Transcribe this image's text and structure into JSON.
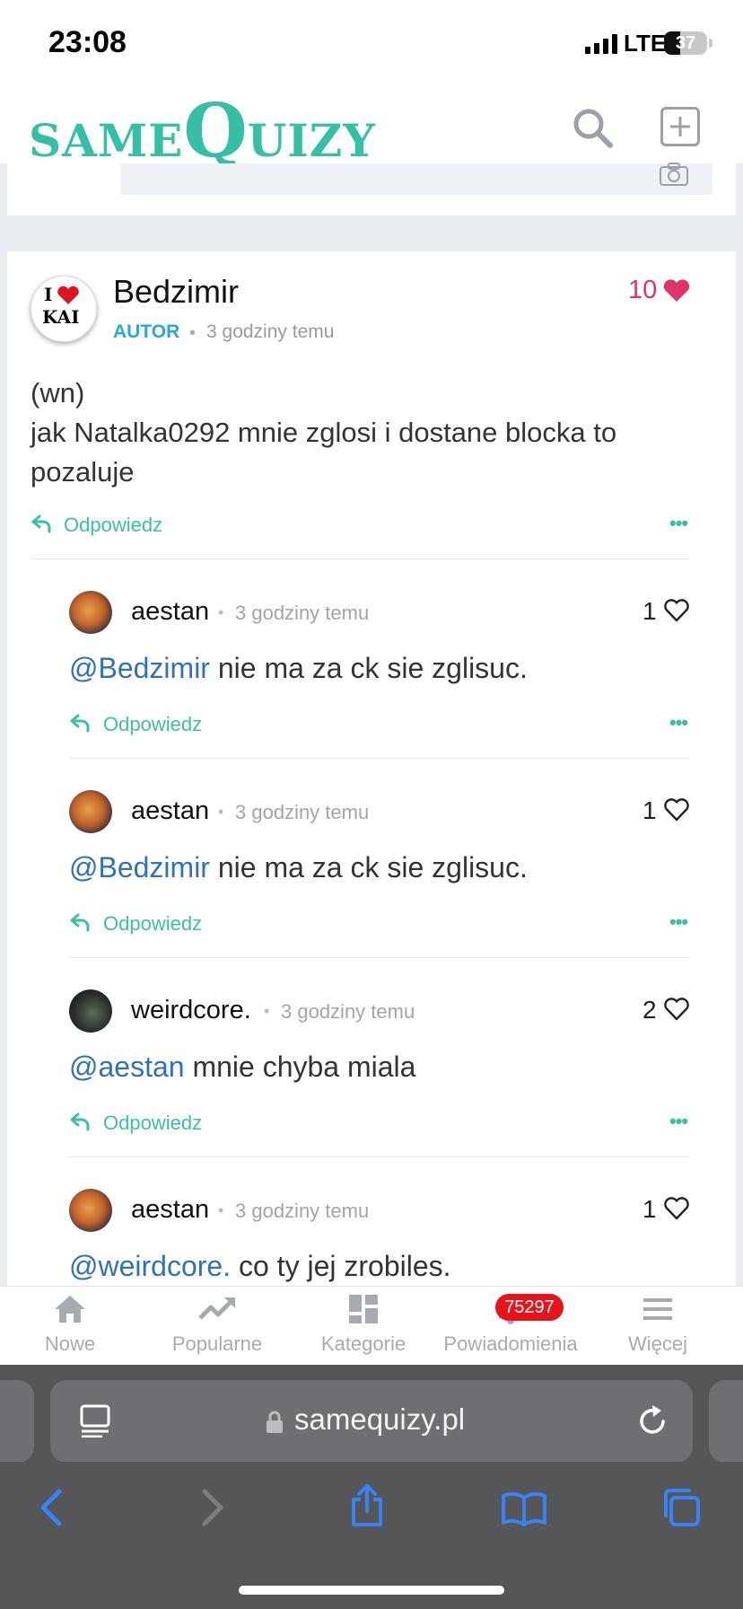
{
  "status_bar": {
    "time": "23:08",
    "network": "LTE",
    "battery": "37",
    "battery_level": 0.37
  },
  "header": {
    "logo_small": "SAME",
    "logo_big": "Q",
    "logo_rest": "UIZY"
  },
  "main_comment": {
    "author": "Bedzimir",
    "avatar_line1": "I",
    "avatar_line2": "KAI",
    "role": "AUTOR",
    "time": "3 godziny temu",
    "likes": "10",
    "text_line1": "(wn)",
    "text_line2": "jak Natalka0292 mnie zglosi i dostane blocka to pozaluje",
    "reply_label": "Odpowiedz",
    "more_label": "•••"
  },
  "replies": [
    {
      "author": "aestan",
      "time": "3 godziny temu",
      "likes": "1",
      "mention": "@Bedzimir",
      "text": " nie ma za ck sie zglisuc.",
      "reply_label": "Odpowiedz",
      "more_label": "•••"
    },
    {
      "author": "aestan",
      "time": "3 godziny temu",
      "likes": "1",
      "mention": "@Bedzimir",
      "text": " nie ma za ck sie zglisuc.",
      "reply_label": "Odpowiedz",
      "more_label": "•••"
    },
    {
      "author": "weirdcore.",
      "time": "3 godziny temu",
      "likes": "2",
      "mention": "@aestan",
      "text": " mnie chyba miala",
      "reply_label": "Odpowiedz",
      "more_label": "•••"
    },
    {
      "author": "aestan",
      "time": "3 godziny temu",
      "likes": "1",
      "mention": "@weirdcore.",
      "text": " co ty jej zrobiles."
    }
  ],
  "tabbar": {
    "tabs": [
      {
        "label": "Nowe",
        "icon": "home-icon"
      },
      {
        "label": "Popularne",
        "icon": "trending-icon"
      },
      {
        "label": "Kategorie",
        "icon": "dashboard-icon"
      },
      {
        "label": "Powiadomienia",
        "icon": "bell-icon"
      },
      {
        "label": "Więcej",
        "icon": "menu-icon"
      }
    ],
    "notification_count": "75297",
    "colors": {
      "badge": "#e8141c",
      "inactive": "#a5abb1"
    }
  },
  "browser": {
    "url": "samequizy.pl"
  },
  "colors": {
    "brand": "#35bfa4",
    "author_role": "#2aa6e0",
    "likes_main": "#e0336a",
    "mention": "#2e72b8"
  }
}
